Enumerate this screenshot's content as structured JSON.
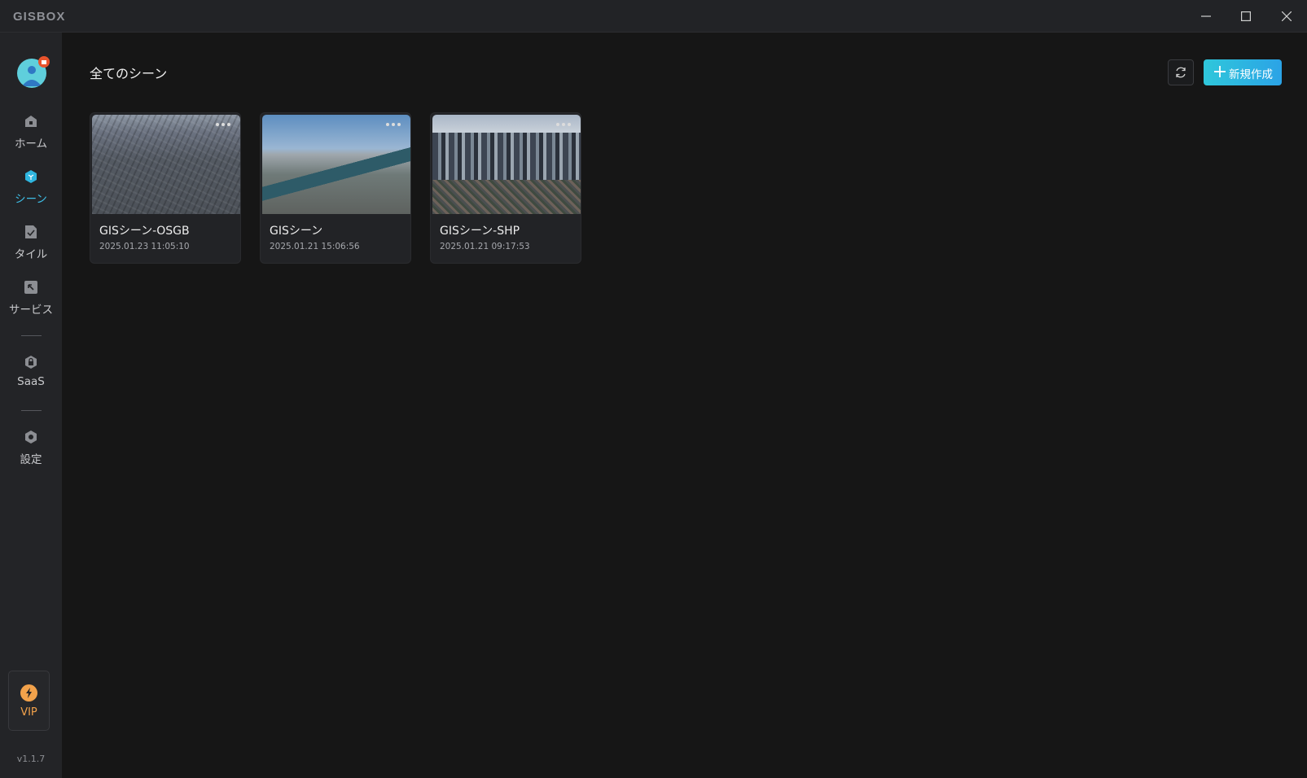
{
  "app": {
    "logo_text": "GISBOX",
    "version": "v1.1.7"
  },
  "sidebar": {
    "items": [
      {
        "id": "home",
        "label": "ホーム",
        "icon": "home-icon"
      },
      {
        "id": "scene",
        "label": "シーン",
        "icon": "cube-icon",
        "active": true
      },
      {
        "id": "tile",
        "label": "タイル",
        "icon": "tile-icon"
      },
      {
        "id": "service",
        "label": "サービス",
        "icon": "service-icon"
      },
      {
        "id": "saas",
        "label": "SaaS",
        "icon": "lock-icon"
      },
      {
        "id": "settings",
        "label": "設定",
        "icon": "settings-icon"
      }
    ],
    "vip_label": "VIP"
  },
  "header": {
    "title": "全てのシーン",
    "new_button_label": "新規作成"
  },
  "scenes": [
    {
      "title": "GISシーン-OSGB",
      "time": "2025.01.23 11:05:10"
    },
    {
      "title": "GISシーン",
      "time": "2025.01.21 15:06:56"
    },
    {
      "title": "GISシーン-SHP",
      "time": "2025.01.21 09:17:53"
    }
  ],
  "colors": {
    "accent": "#2fc7db",
    "active_nav": "#3ebee6",
    "vip": "#f2a24b"
  }
}
